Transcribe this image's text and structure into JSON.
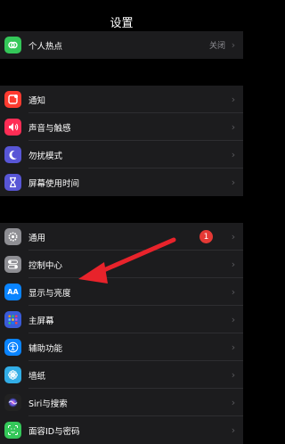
{
  "header": {
    "title": "设置"
  },
  "group1": [
    {
      "label": "个人热点",
      "value": "关闭",
      "icon": "personal-hotspot-icon",
      "color": "#34c759"
    }
  ],
  "group2": [
    {
      "label": "通知",
      "icon": "notifications-icon",
      "color": "#ff3b30"
    },
    {
      "label": "声音与触感",
      "icon": "sounds-icon",
      "color": "#ff2d55"
    },
    {
      "label": "勿扰模式",
      "icon": "moon-icon",
      "color": "#5856d6"
    },
    {
      "label": "屏幕使用时间",
      "icon": "hourglass-icon",
      "color": "#5856d6"
    }
  ],
  "group3": [
    {
      "label": "通用",
      "badge": "1",
      "icon": "gear-icon",
      "color": "#8e8e93"
    },
    {
      "label": "控制中心",
      "icon": "control-center-icon",
      "color": "#8e8e93"
    },
    {
      "label": "显示与亮度",
      "icon": "display-brightness-icon",
      "color": "#0a84ff",
      "icon_text": "AA"
    },
    {
      "label": "主屏幕",
      "icon": "home-screen-icon",
      "color": "#3a5bd9"
    },
    {
      "label": "辅助功能",
      "icon": "accessibility-icon",
      "color": "#0a84ff"
    },
    {
      "label": "墙纸",
      "icon": "wallpaper-icon",
      "color": "#32ade6"
    },
    {
      "label": "Siri与搜索",
      "icon": "siri-icon",
      "color": "#222222"
    },
    {
      "label": "面容ID与密码",
      "icon": "face-id-icon",
      "color": "#34c759"
    }
  ],
  "annotation": {
    "arrow_color": "#e8232b"
  },
  "chevron": "›"
}
